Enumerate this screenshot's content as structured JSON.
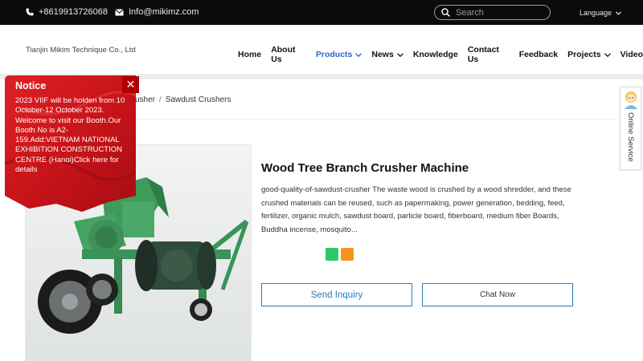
{
  "topbar": {
    "phone": "+8619913726068",
    "email": "Info@mikimz.com",
    "search_placeholder": "Search",
    "language_label": "Language"
  },
  "header": {
    "company": "Tianjin Mikim Technique Co., Ltd",
    "nav": [
      {
        "label": "Home",
        "has_dropdown": false
      },
      {
        "label": "About Us",
        "has_dropdown": false
      },
      {
        "label": "Products",
        "has_dropdown": true,
        "active": true
      },
      {
        "label": "News",
        "has_dropdown": true
      },
      {
        "label": "Knowledge",
        "has_dropdown": false
      },
      {
        "label": "Contact Us",
        "has_dropdown": false
      },
      {
        "label": "Feedback",
        "has_dropdown": false
      },
      {
        "label": "Projects",
        "has_dropdown": true
      },
      {
        "label": "Video",
        "has_dropdown": false
      }
    ]
  },
  "breadcrumb": {
    "partial": "usher",
    "separator": "/",
    "current": "Sawdust Crushers"
  },
  "product": {
    "title": "Wood Tree Branch Crusher Machine",
    "description": "good-quality-of-sawdust-crusher The waste wood is crushed by a wood shredder, and these crushed materials can be reused, such as papermaking, power generation, bedding, feed, fertilizer, organic mulch, sawdust board, particle board, fiberboard, medium fiber Boards, Buddha incense, mosquito...",
    "share_colors": [
      "#2ec866",
      "#f7941d"
    ],
    "inquiry_label": "Send Inquiry",
    "chat_label": "Chat Now"
  },
  "online_service": {
    "label": "Online Service"
  },
  "notice": {
    "title": "Notice",
    "close_symbol": "✕",
    "text": "2023 VIIF will be holden from 10 October-12 October 2023. Welcome to visit our Booth.Our Booth No is A2-159.Add:VIETNAM NATIONAL EXHIBITION CONSTRUCTION CENTRE (Hanoi)Click here for details"
  },
  "colors": {
    "accent": "#2b66c6",
    "button_border": "#2a7bb5",
    "notice_red": "#cf1418",
    "topbar": "#0b0b0b"
  }
}
